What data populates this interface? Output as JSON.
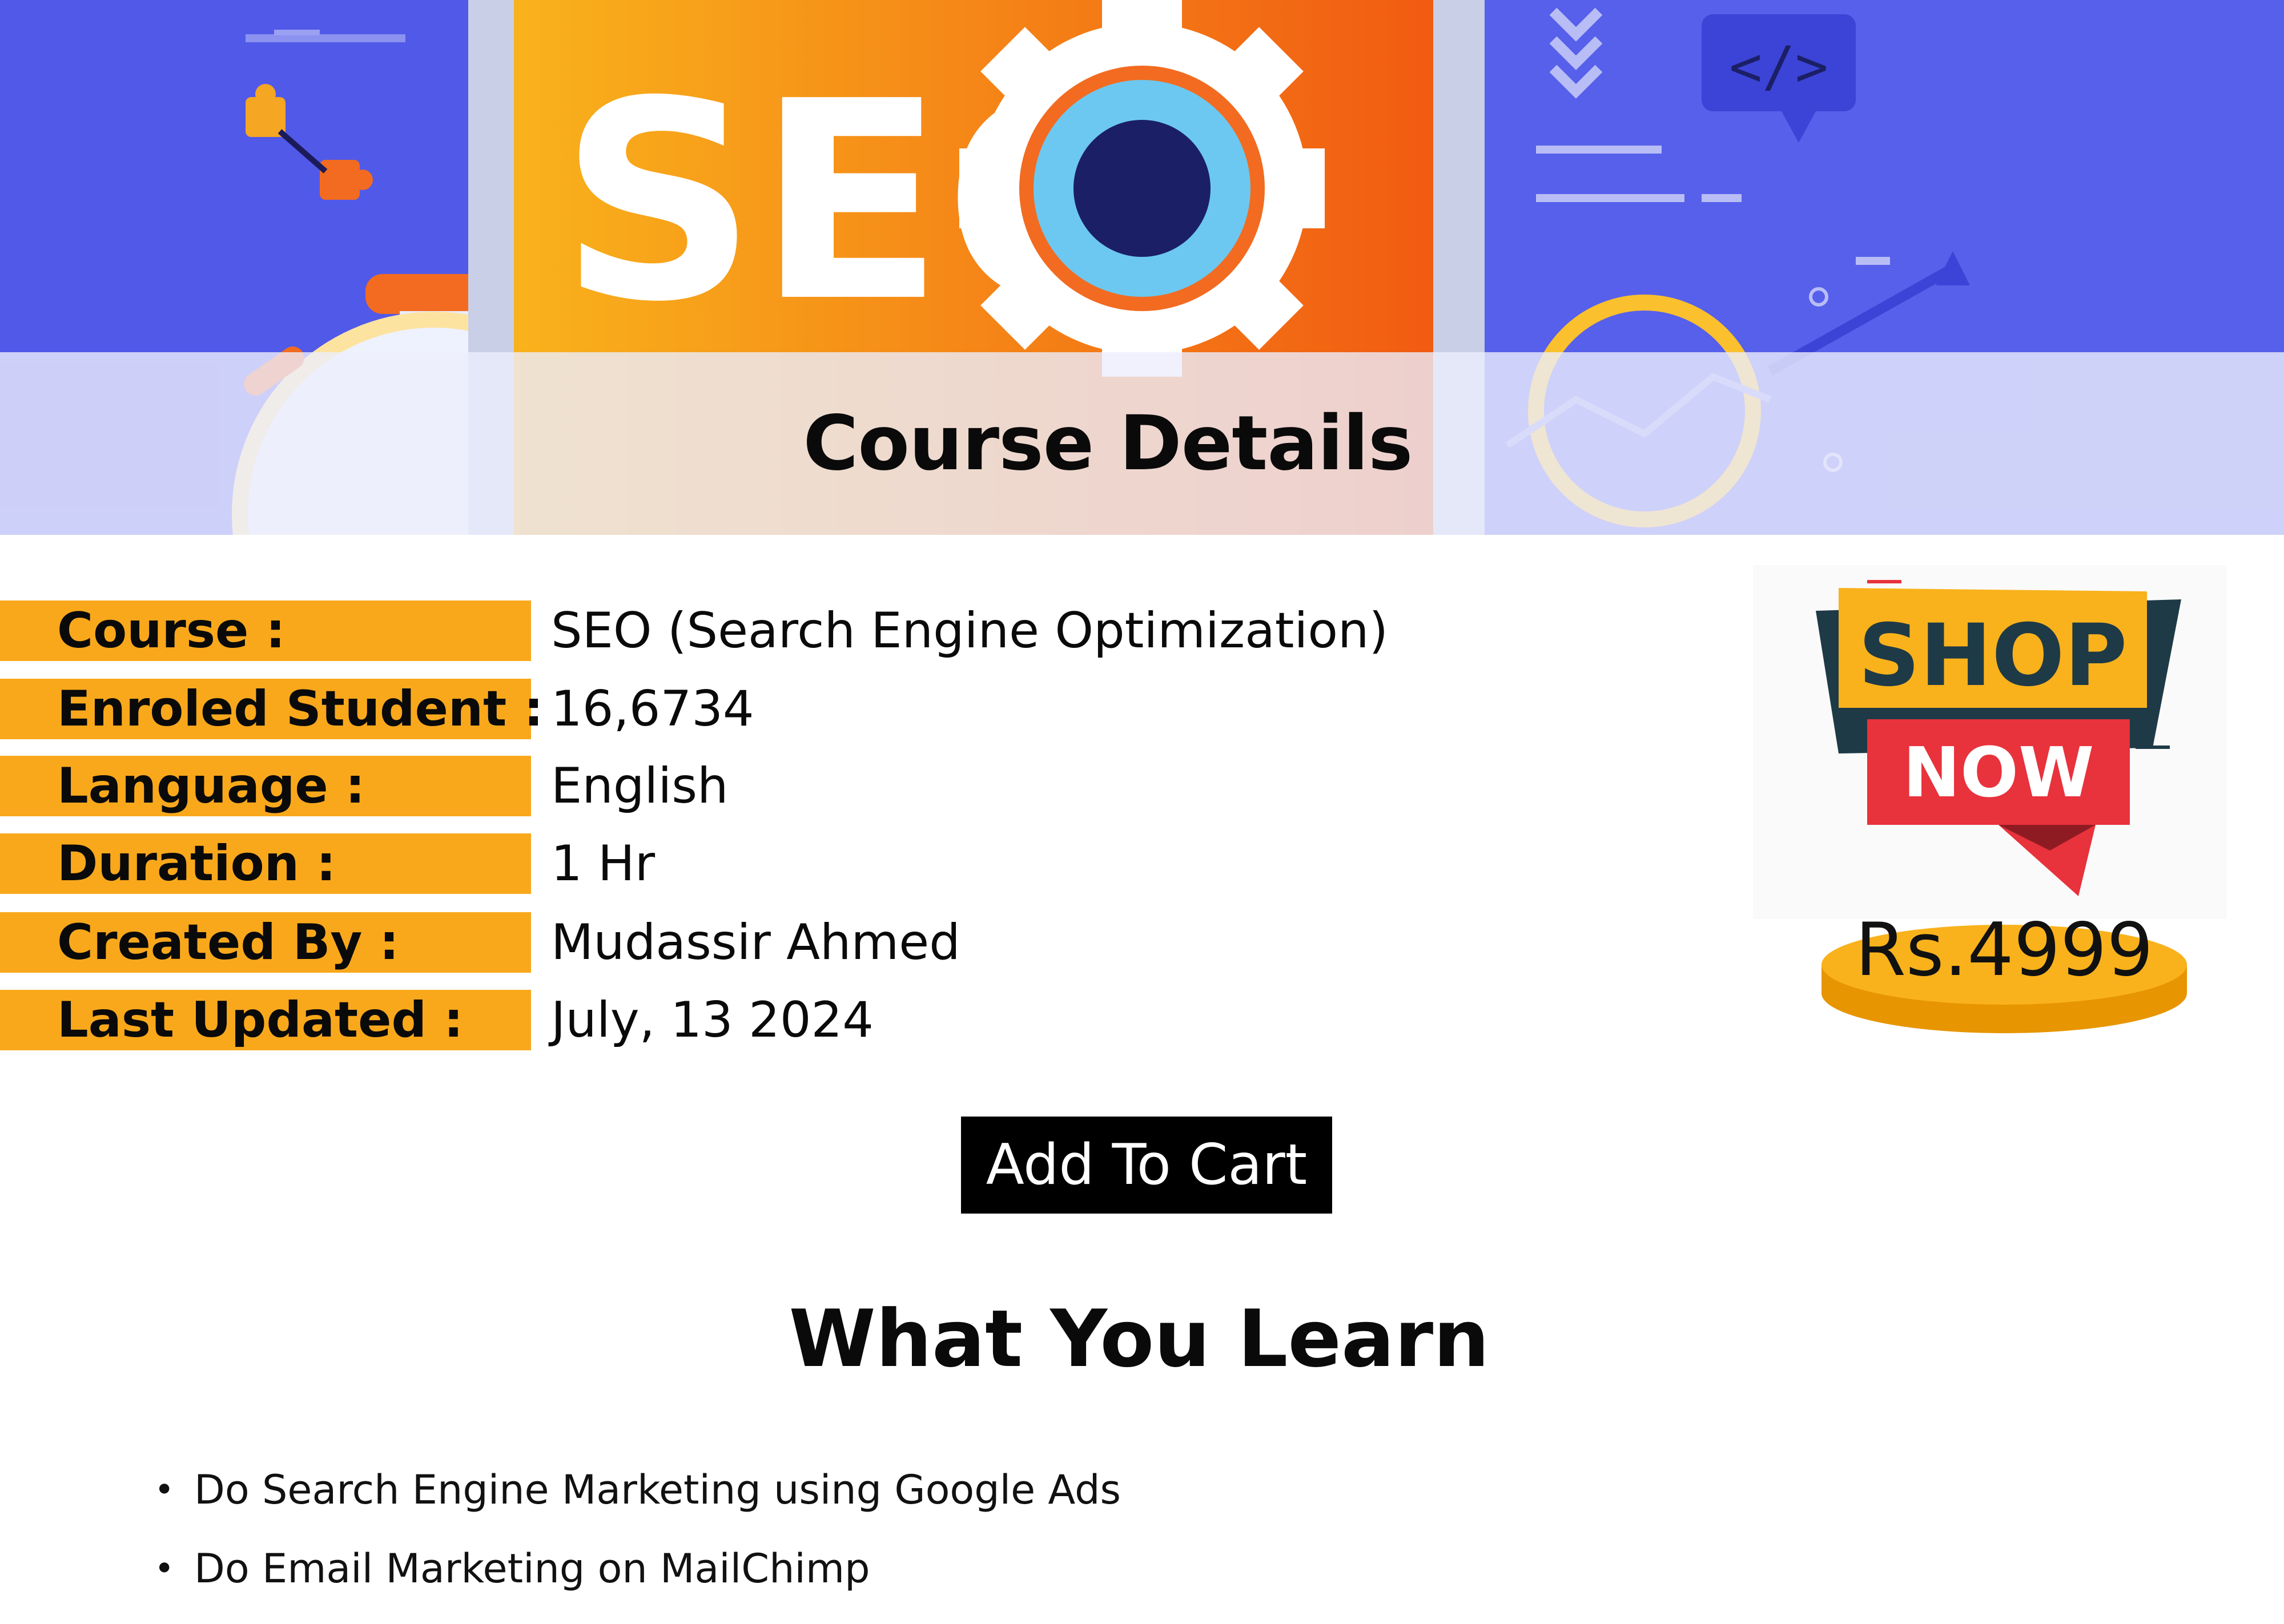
{
  "banner": {
    "title": "Course Details",
    "art_text": "SEO",
    "code_icon_text": "</>"
  },
  "details": [
    {
      "label": "Course :",
      "value": "SEO (Search Engine Optimization)"
    },
    {
      "label": "Enroled Student :",
      "value": "16,6734"
    },
    {
      "label": "Language :",
      "value": "English"
    },
    {
      "label": "Duration :",
      "value": "1 Hr"
    },
    {
      "label": "Created By :",
      "value": "Mudassir Ahmed"
    },
    {
      "label": "Last Updated :",
      "value": "July, 13 2024"
    }
  ],
  "shop_badge": {
    "line1": "SHOP",
    "line2": "NOW",
    "price": "Rs.4999"
  },
  "cart": {
    "label": "Add To Cart"
  },
  "learn": {
    "title": "What You Learn",
    "items": [
      "Do Search Engine Marketing using Google Ads",
      "Do Email Marketing on MailChimp"
    ]
  },
  "colors": {
    "banner_blue": "#5159e8",
    "label_orange": "#f9a81c",
    "button_black": "#000000",
    "badge_red": "#e8323c",
    "badge_dark": "#1e3a46"
  }
}
